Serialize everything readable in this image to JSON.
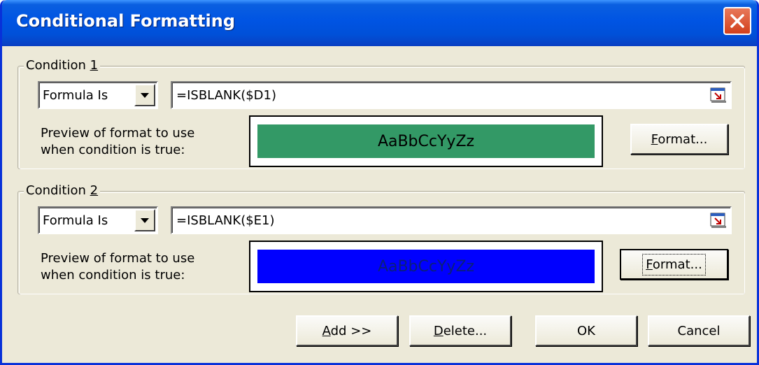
{
  "window": {
    "title": "Conditional Formatting"
  },
  "conditions": [
    {
      "legend_prefix": "Condition ",
      "legend_number": "1",
      "type": "Formula Is",
      "formula": "=ISBLANK($D1)",
      "preview_label_line1": "Preview of format to use",
      "preview_label_line2": "when condition is true:",
      "preview_text": "AaBbCcYyZz",
      "preview_bg": "#339966",
      "preview_fg": "#000000",
      "format_button_prefix": "F",
      "format_button_rest": "ormat..."
    },
    {
      "legend_prefix": "Condition ",
      "legend_number": "2",
      "type": "Formula Is",
      "formula": "=ISBLANK($E1)",
      "preview_label_line1": "Preview of format to use",
      "preview_label_line2": "when condition is true:",
      "preview_text": "AaBbCcYyZz",
      "preview_bg": "#0000ff",
      "preview_fg": "#0b1f7a",
      "format_button_prefix": "F",
      "format_button_rest": "ormat..."
    }
  ],
  "buttons": {
    "add_prefix": "A",
    "add_rest": "dd >>",
    "delete_prefix": "D",
    "delete_rest": "elete...",
    "ok": "OK",
    "cancel": "Cancel"
  }
}
